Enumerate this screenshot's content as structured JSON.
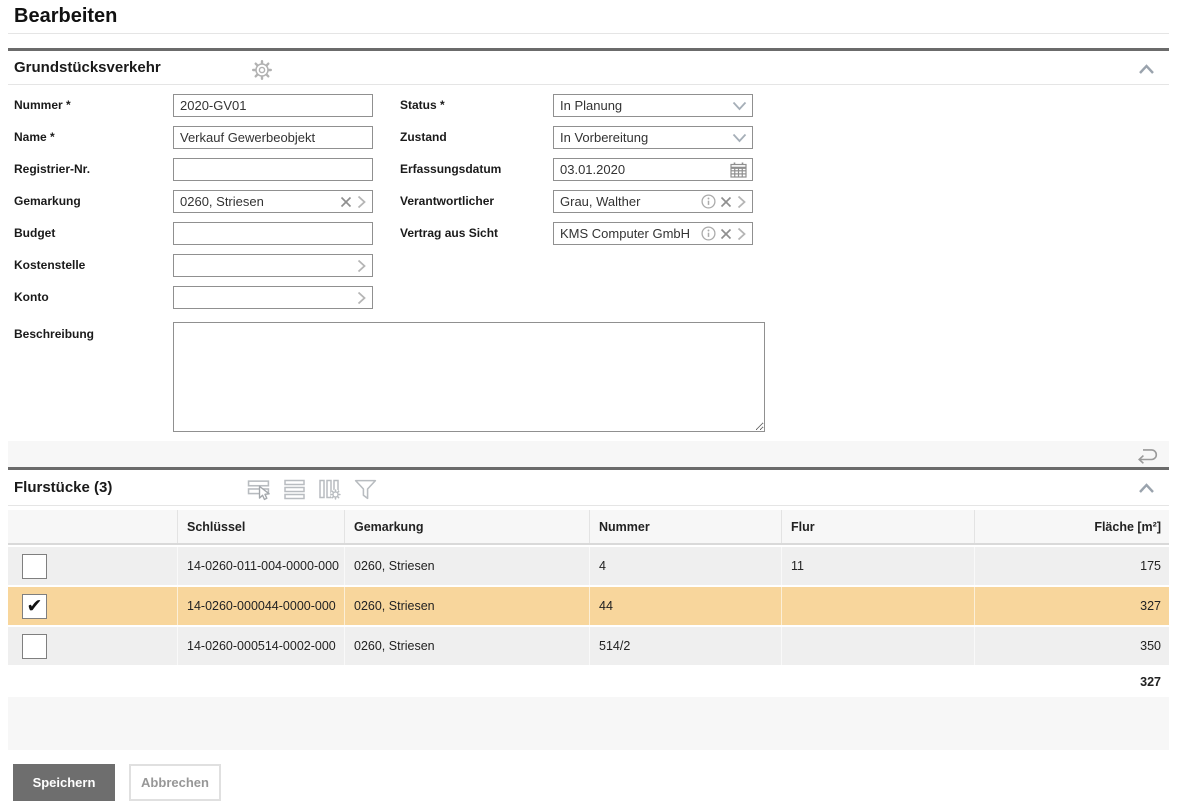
{
  "page": {
    "title": "Bearbeiten"
  },
  "colors": {
    "section_border": "#6b6b6b",
    "row_background": "#efefef",
    "selected_row_background": "#f8d69c",
    "table_header_background": "#f7f7f7",
    "primary_button_background": "#6e6e6e",
    "field_border": "#909090"
  },
  "icons": {
    "settings": "gear-icon",
    "collapse": "chevron-up-icon",
    "clear": "x-icon",
    "open_lookup": "chevron-right-icon",
    "dropdown": "chevron-down-icon",
    "info": "info-icon",
    "date": "calendar-icon",
    "undo": "undo-arrow-icon",
    "table_toolbar": [
      "select-rows-icon",
      "rows-icon",
      "column-settings-icon",
      "filter-icon"
    ],
    "checkmark": "✔"
  },
  "sections": {
    "grundstuecksverkehr": {
      "title": "Grundstücksverkehr",
      "fields": {
        "nummer": {
          "label": "Nummer *",
          "value": "2020-GV01"
        },
        "name": {
          "label": "Name *",
          "value": "Verkauf Gewerbeobjekt"
        },
        "registrier_nr": {
          "label": "Registrier-Nr.",
          "value": ""
        },
        "gemarkung": {
          "label": "Gemarkung",
          "value": "0260, Striesen"
        },
        "budget": {
          "label": "Budget",
          "value": ""
        },
        "kostenstelle": {
          "label": "Kostenstelle",
          "value": ""
        },
        "konto": {
          "label": "Konto",
          "value": ""
        },
        "beschreibung": {
          "label": "Beschreibung",
          "value": ""
        },
        "status": {
          "label": "Status *",
          "value": "In Planung"
        },
        "zustand": {
          "label": "Zustand",
          "value": "In Vorbereitung"
        },
        "erfassungsdatum": {
          "label": "Erfassungsdatum",
          "value": "03.01.2020"
        },
        "verantwortlicher": {
          "label": "Verantwortlicher",
          "value": "Grau, Walther"
        },
        "vertrag_aus_sicht": {
          "label": "Vertrag aus Sicht",
          "value": "KMS Computer GmbH"
        }
      }
    },
    "flurstuecke": {
      "title": "Flurstücke (3)",
      "columns": {
        "schluessel": "Schlüssel",
        "gemarkung": "Gemarkung",
        "nummer": "Nummer",
        "flur": "Flur",
        "flaeche": "Fläche [m²]"
      },
      "rows": [
        {
          "checked": false,
          "selected": false,
          "schluessel": "14-0260-011-004-0000-000",
          "gemarkung": "0260, Striesen",
          "nummer": "4",
          "flur": "11",
          "flaeche": "175"
        },
        {
          "checked": true,
          "selected": true,
          "schluessel": "14-0260-000044-0000-000",
          "gemarkung": "0260, Striesen",
          "nummer": "44",
          "flur": "",
          "flaeche": "327"
        },
        {
          "checked": false,
          "selected": false,
          "schluessel": "14-0260-000514-0002-000",
          "gemarkung": "0260, Striesen",
          "nummer": "514/2",
          "flur": "",
          "flaeche": "350"
        }
      ],
      "sum_flaeche": "327"
    }
  },
  "actions": {
    "save": "Speichern",
    "cancel": "Abbrechen"
  }
}
